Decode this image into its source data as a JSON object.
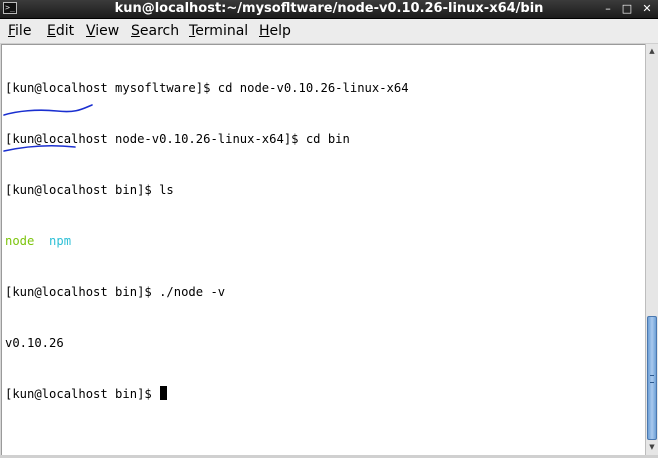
{
  "window": {
    "icon": "terminal-icon",
    "title": "kun@localhost:~/mysofltware/node-v0.10.26-linux-x64/bin",
    "buttons": {
      "minimize": "minimize-icon",
      "maximize": "maximize-icon",
      "close": "close-icon"
    }
  },
  "menu": {
    "file": "File",
    "edit": "Edit",
    "view": "View",
    "search": "Search",
    "terminal": "Terminal",
    "help": "Help"
  },
  "terminal": {
    "lines": [
      "[kun@localhost mysofltware]$ cd node-v0.10.26-linux-x64",
      "[kun@localhost node-v0.10.26-linux-x64]$ cd bin",
      "[kun@localhost bin]$ ls"
    ],
    "ls_output": {
      "node": "node",
      "npm": "npm"
    },
    "line_node_cmd": "[kun@localhost bin]$ ./node -v",
    "version_output": "v0.10.26",
    "current_prompt": "[kun@localhost bin]$ ",
    "colors": {
      "node": "#7cc40d",
      "npm": "#2ec0d6",
      "annotation": "#1a2fd0"
    }
  },
  "scrollbar": {
    "up": "scroll-up-arrow-icon",
    "down": "scroll-down-arrow-icon",
    "position": 1.0
  }
}
